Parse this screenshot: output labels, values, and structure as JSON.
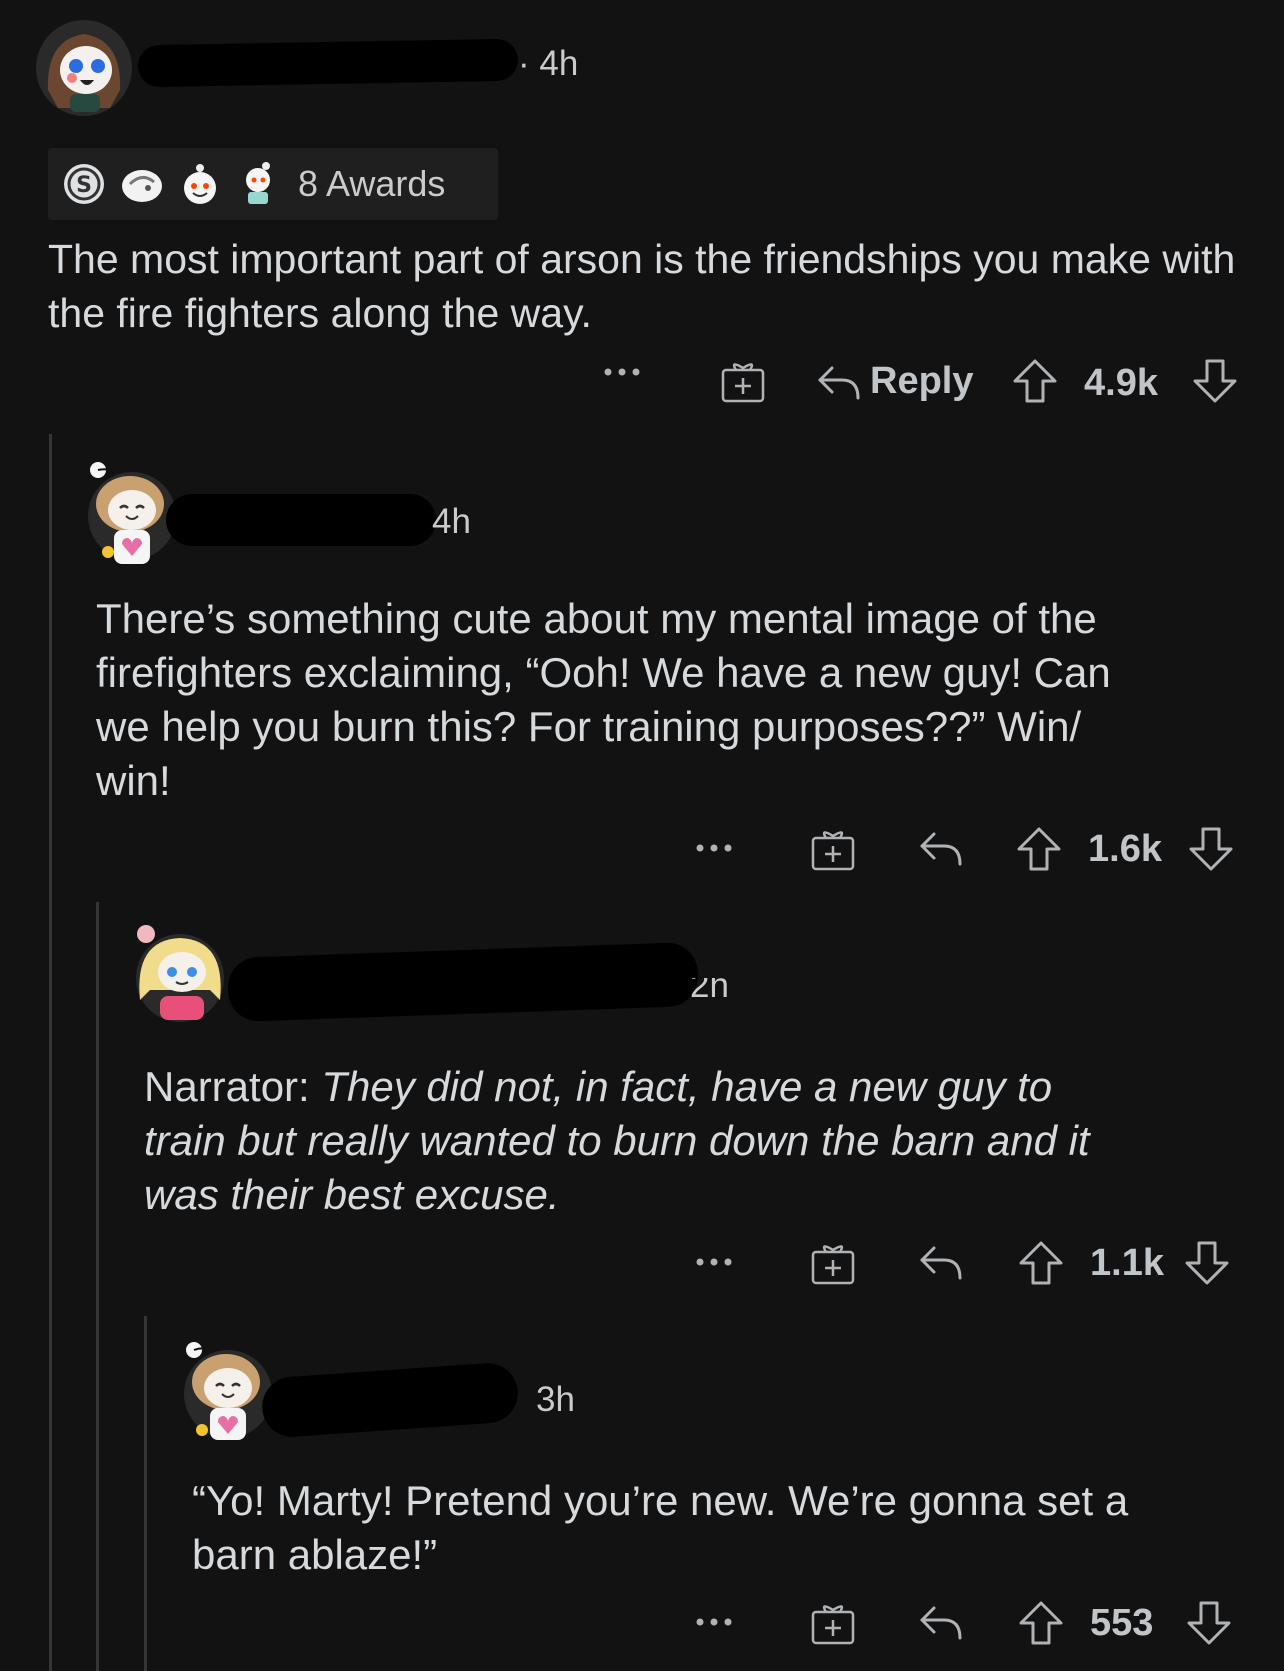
{
  "comments": [
    {
      "time": "4h",
      "awards_label": "8 Awards",
      "awards": [
        "silver-award-icon",
        "facepalm-award-icon",
        "wholesome-award-icon",
        "snoo-award-icon"
      ],
      "text": "The most important part of arson is the friendships you make with the fire fighters along the way.",
      "reply_label": "Reply",
      "score": "4.9k"
    },
    {
      "time": "4h",
      "text_line1": "There’s something cute about my mental image of the",
      "text_line2": "firefighters exclaiming, “Ooh! We have a new guy! Can",
      "text_line3": "we help you burn this? For training purposes??” Win/",
      "text_line4": "win!",
      "score": "1.6k"
    },
    {
      "time": "2h",
      "text_prefix": "Narrator: ",
      "text_italic1": "They did not, in fact, have a new guy to",
      "text_italic2": "train but really wanted to burn down the barn and it",
      "text_italic3": "was their best excuse.",
      "score": "1.1k"
    },
    {
      "time": "3h",
      "text_line1": "“Yo! Marty! Pretend you’re new. We’re gonna set a",
      "text_line2": "barn ablaze!”",
      "score": "553"
    }
  ],
  "colors": {
    "background": "#121213",
    "text": "#d7dadc",
    "thread_line": "#343536"
  }
}
